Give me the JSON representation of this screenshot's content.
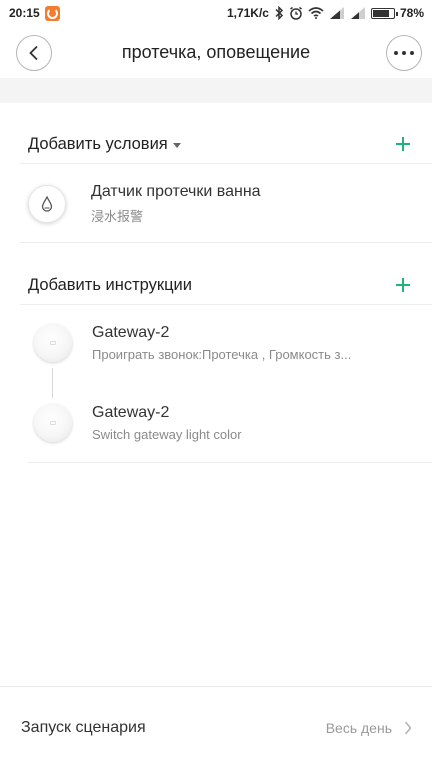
{
  "status_bar": {
    "time": "20:15",
    "speed": "1,71K/c",
    "battery": "78%",
    "battery_level": 0.78
  },
  "header": {
    "title": "протечка, оповещение"
  },
  "conditions": {
    "title": "Добавить условия",
    "items": [
      {
        "title": "Датчик протечки ванна",
        "subtitle": "浸水报警"
      }
    ]
  },
  "instructions": {
    "title": "Добавить инструкции",
    "items": [
      {
        "title": "Gateway-2",
        "subtitle": "Проиграть звонок:Протечка , Громкость з..."
      },
      {
        "title": "Gateway-2",
        "subtitle": "Switch gateway light color"
      }
    ]
  },
  "bottom": {
    "label": "Запуск сценария",
    "value": "Весь день"
  },
  "colors": {
    "accent": "#21b37a",
    "notification": "#f47c2c"
  }
}
